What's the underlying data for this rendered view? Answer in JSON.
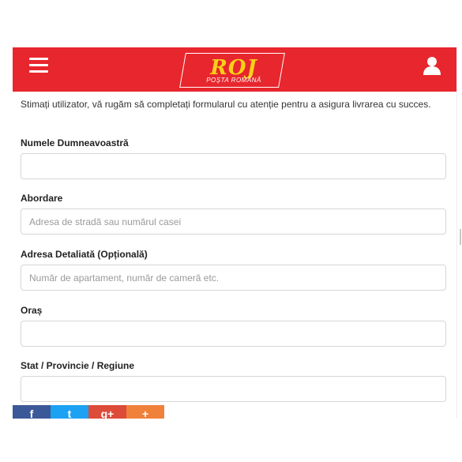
{
  "header": {
    "logo_mark": "ROJ",
    "logo_text": "POŞTA ROMÂNĂ"
  },
  "intro": "Stimați utilizator, vă rugăm să completați formularul cu atenție pentru a asigura livrarea cu succes.",
  "form": {
    "name": {
      "label": "Numele Dumneavoastră",
      "value": "",
      "placeholder": ""
    },
    "address": {
      "label": "Abordare",
      "value": "",
      "placeholder": "Adresa de stradă sau numărul casei"
    },
    "address_detail": {
      "label": "Adresa Detaliată (Opțională)",
      "value": "",
      "placeholder": "Număr de apartament, număr de cameră etc."
    },
    "city": {
      "label": "Oraș",
      "value": "",
      "placeholder": ""
    },
    "state": {
      "label": "Stat / Provincie / Regiune",
      "value": "",
      "placeholder": ""
    }
  },
  "share": {
    "facebook": "f",
    "twitter": "t",
    "google": "g+",
    "more": "+"
  },
  "colors": {
    "header_bg": "#e8262d",
    "logo_yellow": "#f7d117",
    "facebook": "#3b5998",
    "twitter": "#1da1f2",
    "google": "#dd4b39",
    "more": "#f0813a"
  }
}
